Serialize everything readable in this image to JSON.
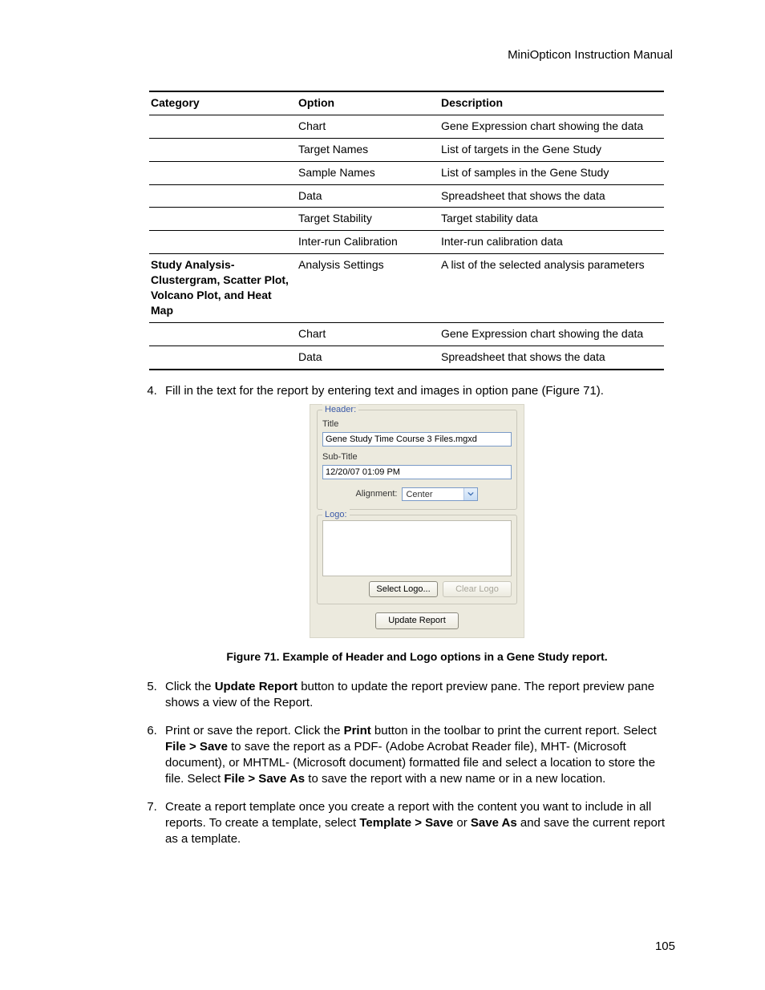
{
  "header": {
    "running": "MiniOpticon Instruction Manual"
  },
  "table": {
    "headers": {
      "c1": "Category",
      "c2": "Option",
      "c3": "Description"
    },
    "rows": [
      {
        "cat": "",
        "opt": "Chart",
        "desc": "Gene Expression chart showing the data"
      },
      {
        "cat": "",
        "opt": "Target Names",
        "desc": "List of targets in the Gene Study"
      },
      {
        "cat": "",
        "opt": "Sample Names",
        "desc": "List of samples in the Gene Study"
      },
      {
        "cat": "",
        "opt": "Data",
        "desc": "Spreadsheet that shows the data"
      },
      {
        "cat": "",
        "opt": "Target Stability",
        "desc": "Target stability data"
      },
      {
        "cat": "",
        "opt": "Inter-run Calibration",
        "desc": "Inter-run calibration data"
      },
      {
        "cat": "Study Analysis-Clustergram, Scatter Plot, Volcano Plot, and Heat Map",
        "opt": "Analysis Settings",
        "desc": "A list of the selected analysis parameters"
      },
      {
        "cat": "",
        "opt": "Chart",
        "desc": "Gene Expression chart showing the data"
      },
      {
        "cat": "",
        "opt": "Data",
        "desc": "Spreadsheet that shows the data"
      }
    ]
  },
  "steps": {
    "s4": "Fill in the text for the report by entering text and images in option pane (Figure 71).",
    "s5_a": "Click the ",
    "s5_b": "Update Report",
    "s5_c": " button to update the report preview pane. The report preview pane shows a view of the Report.",
    "s6_a": "Print or save the report. Click the ",
    "s6_b": "Print",
    "s6_c": " button in the toolbar to print the current report. Select ",
    "s6_d": "File > Save",
    "s6_e": " to save the report as a PDF- (Adobe Acrobat Reader file), MHT- (Microsoft document), or MHTML- (Microsoft document) formatted file and select a location to store the file. Select ",
    "s6_f": "File > Save As",
    "s6_g": " to save the report with a new name or in a new location.",
    "s7_a": "Create a report template once you create a report with the content you want to include in all reports. To create a template, select ",
    "s7_b": "Template > Save",
    "s7_c": " or ",
    "s7_d": "Save As",
    "s7_e": " and save the current report as a template."
  },
  "figure": {
    "caption": "Figure 71. Example of Header and Logo options in a Gene Study report.",
    "header_legend": "Header:",
    "title_label": "Title",
    "title_value": "Gene Study Time Course 3 Files.mgxd",
    "subtitle_label": "Sub-Title",
    "subtitle_value": "12/20/07 01:09 PM",
    "alignment_label": "Alignment:",
    "alignment_value": "Center",
    "logo_legend": "Logo:",
    "select_logo": "Select Logo...",
    "clear_logo": "Clear Logo",
    "update_report": "Update Report"
  },
  "page_number": "105"
}
